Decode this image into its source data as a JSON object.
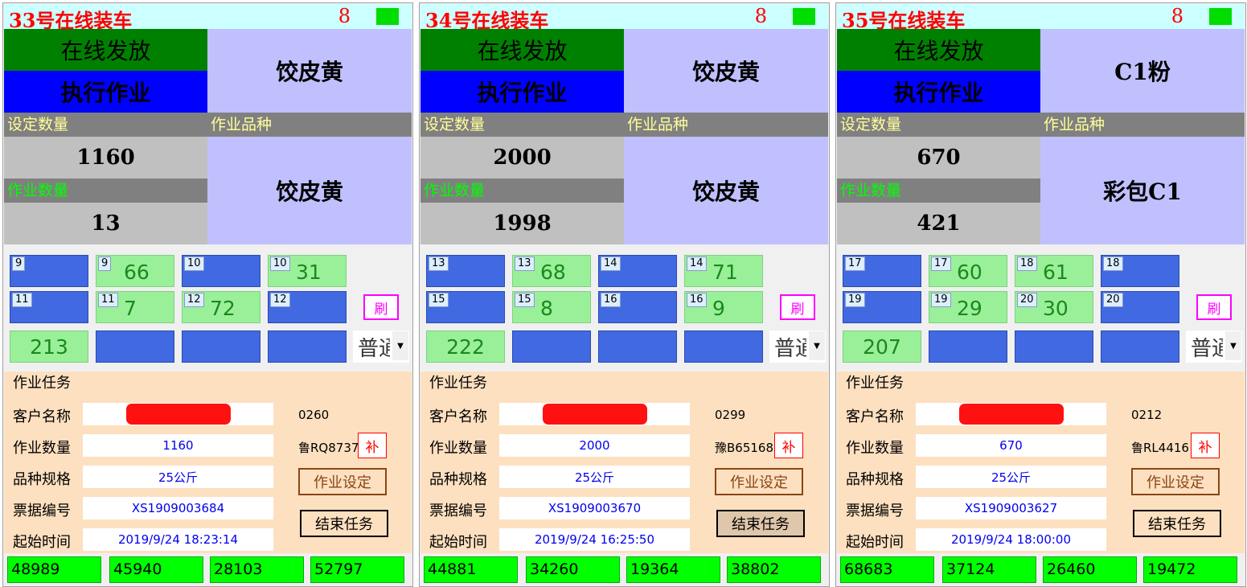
{
  "panels": [
    {
      "title": "33号在线装车",
      "count": "8",
      "status_top": "在线发放",
      "status_bottom": "执行作业",
      "product_top": "饺皮黄",
      "label_set_qty": "设定数量",
      "label_product": "作业品种",
      "label_work_qty": "作业数量",
      "set_qty": "1160",
      "work_qty": "13",
      "product_main": "饺皮黄",
      "cells": [
        {
          "tag": "9",
          "val": "",
          "color": "blue"
        },
        {
          "tag": "9",
          "val": "66",
          "color": "green"
        },
        {
          "tag": "10",
          "val": "",
          "color": "blue"
        },
        {
          "tag": "10",
          "val": "31",
          "color": "green"
        },
        {
          "tag": "11",
          "val": "",
          "color": "blue"
        },
        {
          "tag": "11",
          "val": "7",
          "color": "green"
        },
        {
          "tag": "12",
          "val": "72",
          "color": "green"
        },
        {
          "tag": "12",
          "val": "",
          "color": "blue"
        }
      ],
      "total": "213",
      "refresh": "刷",
      "combo_value": "普通",
      "task": {
        "group_title": "作业任务",
        "labels": [
          "客户名称",
          "作业数量",
          "品种规格",
          "票据编号",
          "起始时间"
        ],
        "code": "0260",
        "plate": "鲁RQ8737",
        "supplement": "补",
        "work_qty": "1160",
        "spec": "25公斤",
        "ticket": "XS1909003684",
        "start": "2019/9/24 18:23:14",
        "btn_set": "作业设定",
        "btn_end": "结束任务",
        "end_pressed": false
      },
      "bottom": [
        "48989",
        "45940",
        "28103",
        "52797"
      ]
    },
    {
      "title": "34号在线装车",
      "count": "8",
      "status_top": "在线发放",
      "status_bottom": "执行作业",
      "product_top": "饺皮黄",
      "label_set_qty": "设定数量",
      "label_product": "作业品种",
      "label_work_qty": "作业数量",
      "set_qty": "2000",
      "work_qty": "1998",
      "product_main": "饺皮黄",
      "cells": [
        {
          "tag": "13",
          "val": "",
          "color": "blue"
        },
        {
          "tag": "13",
          "val": "68",
          "color": "green"
        },
        {
          "tag": "14",
          "val": "",
          "color": "blue"
        },
        {
          "tag": "14",
          "val": "71",
          "color": "green"
        },
        {
          "tag": "15",
          "val": "",
          "color": "blue"
        },
        {
          "tag": "15",
          "val": "8",
          "color": "green"
        },
        {
          "tag": "16",
          "val": "",
          "color": "blue"
        },
        {
          "tag": "16",
          "val": "9",
          "color": "green"
        }
      ],
      "total": "222",
      "refresh": "刷",
      "combo_value": "普通",
      "task": {
        "group_title": "作业任务",
        "labels": [
          "客户名称",
          "作业数量",
          "品种规格",
          "票据编号",
          "起始时间"
        ],
        "code": "0299",
        "plate": "豫B65168",
        "supplement": "补",
        "work_qty": "2000",
        "spec": "25公斤",
        "ticket": "XS1909003670",
        "start": "2019/9/24 16:25:50",
        "btn_set": "作业设定",
        "btn_end": "结束任务",
        "end_pressed": true
      },
      "bottom": [
        "44881",
        "34260",
        "19364",
        "38802"
      ]
    },
    {
      "title": "35号在线装车",
      "count": "8",
      "status_top": "在线发放",
      "status_bottom": "执行作业",
      "product_top": "C1粉",
      "label_set_qty": "设定数量",
      "label_product": "作业品种",
      "label_work_qty": "作业数量",
      "set_qty": "670",
      "work_qty": "421",
      "product_main": "彩包C1",
      "cells": [
        {
          "tag": "17",
          "val": "",
          "color": "blue"
        },
        {
          "tag": "17",
          "val": "60",
          "color": "green"
        },
        {
          "tag": "18",
          "val": "61",
          "color": "green"
        },
        {
          "tag": "18",
          "val": "",
          "color": "blue"
        },
        {
          "tag": "19",
          "val": "",
          "color": "blue"
        },
        {
          "tag": "19",
          "val": "29",
          "color": "green"
        },
        {
          "tag": "20",
          "val": "30",
          "color": "green"
        },
        {
          "tag": "20",
          "val": "",
          "color": "blue"
        }
      ],
      "total": "207",
      "refresh": "刷",
      "combo_value": "普通",
      "task": {
        "group_title": "作业任务",
        "labels": [
          "客户名称",
          "作业数量",
          "品种规格",
          "票据编号",
          "起始时间"
        ],
        "code": "0212",
        "plate": "鲁RL4416",
        "supplement": "补",
        "work_qty": "670",
        "spec": "25公斤",
        "ticket": "XS1909003627",
        "start": "2019/9/24 18:00:00",
        "btn_set": "作业设定",
        "btn_end": "结束任务",
        "end_pressed": false
      },
      "bottom": [
        "68683",
        "37124",
        "26460",
        "19472"
      ]
    }
  ],
  "colors": {
    "title_bg": "#ccffff",
    "title_text": "#ff0000",
    "indicator": "#00dd00",
    "status_top_bg": "#008000",
    "status_bottom_bg": "#0000ff",
    "lavender": "#c0c0ff",
    "label_bar": "#808080",
    "label_yellow": "#ffff99",
    "label_green": "#00ff00",
    "qty_bg": "#c0c0c0",
    "cell_blue": "#4169e1",
    "cell_green": "#99f099",
    "task_bg": "#fde0c0",
    "bottom_green": "#00ff00"
  }
}
